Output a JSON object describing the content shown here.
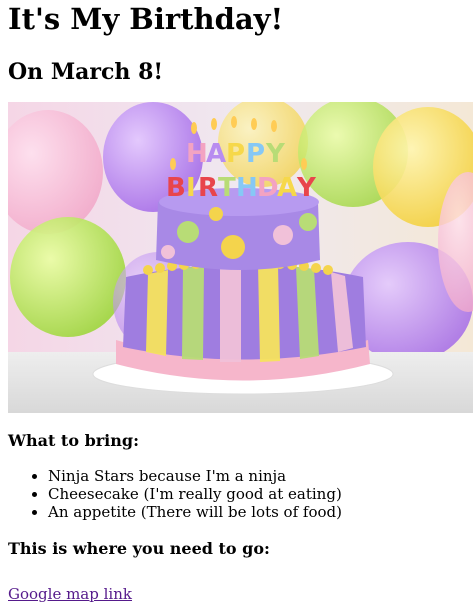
{
  "header": {
    "title": "It's My Birthday!",
    "subtitle": "On March 8!"
  },
  "hero_image": {
    "description_label": "",
    "topper_text": "HAPPY BIRTHDAY"
  },
  "bring": {
    "heading": "What to bring:",
    "items": [
      "Ninja Stars because I'm a ninja",
      "Cheesecake (I'm really good at eating)",
      "An appetite (There will be lots of food)"
    ]
  },
  "location": {
    "heading": "This is where you need to go:",
    "link_text": "Google map link"
  },
  "colors": {
    "link_visited": "#551A8B",
    "text": "#000000",
    "background": "#ffffff"
  }
}
